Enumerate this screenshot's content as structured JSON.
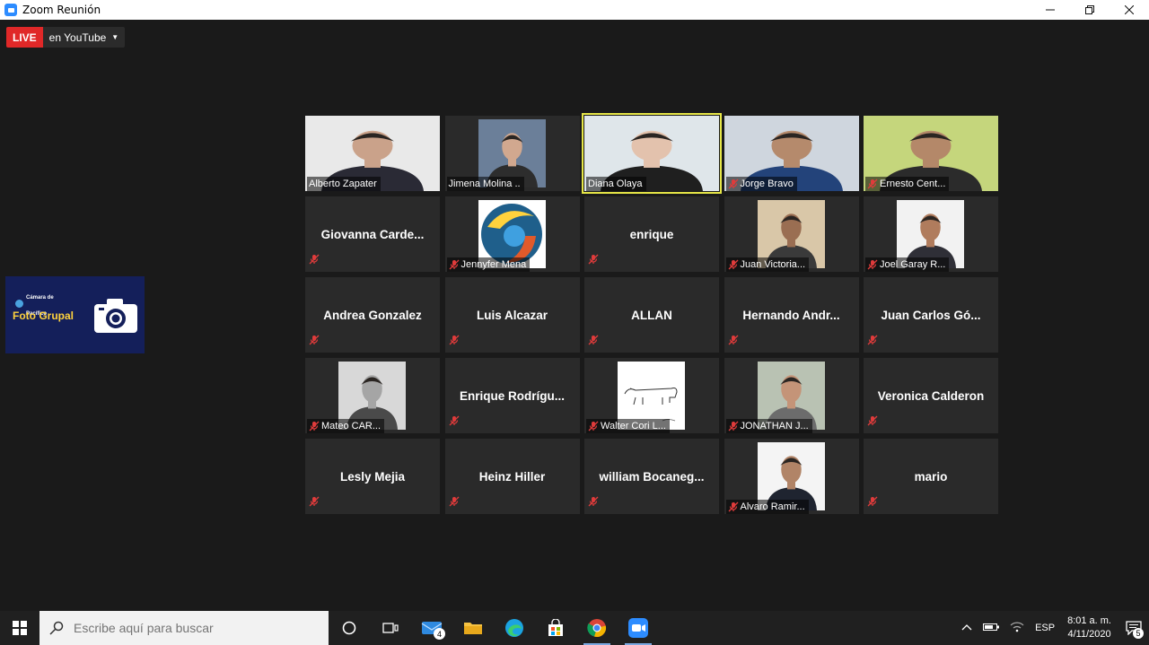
{
  "window": {
    "title": "Zoom Reunión"
  },
  "live": {
    "badge": "LIVE",
    "destination": "en YouTube"
  },
  "foto_grupal": {
    "label": "Foto Grupal",
    "logo_line1": "Cámara de",
    "logo_line2": "Pacífico"
  },
  "participants": [
    {
      "name": "Alberto Zapater",
      "muted": false,
      "kind": "video",
      "bg": "#e9e9e9",
      "skin": "#caa28a",
      "shirt": "#2a2a35"
    },
    {
      "name": "Jimena Molina ..",
      "muted": false,
      "kind": "photo",
      "bg": "#6b7f99",
      "skin": "#d1a88f",
      "shirt": "#2d2d2d"
    },
    {
      "name": "Diana Olaya",
      "muted": false,
      "kind": "video",
      "bg": "#dfe6ea",
      "skin": "#e3c2ad",
      "shirt": "#1f1f1f",
      "speaker": true
    },
    {
      "name": "Jorge Bravo",
      "muted": true,
      "kind": "video",
      "bg": "#cfd6de",
      "skin": "#b58a6c",
      "shirt": "#23437a"
    },
    {
      "name": "Ernesto Cent...",
      "muted": true,
      "kind": "video",
      "bg": "#c5d67c",
      "skin": "#b48869",
      "shirt": "#2b2b2b"
    },
    {
      "name": "Giovanna  Carde...",
      "muted": true,
      "kind": "text"
    },
    {
      "name": "Jennyfer Mena",
      "muted": true,
      "kind": "logo"
    },
    {
      "name": "enrique",
      "muted": true,
      "kind": "text"
    },
    {
      "name": "Juan Victoria...",
      "muted": true,
      "kind": "photo",
      "bg": "#d9c7a8",
      "skin": "#9a6e52",
      "shirt": "#3a3a3a"
    },
    {
      "name": "Joel Garay R...",
      "muted": true,
      "kind": "photo",
      "bg": "#f2f2f2",
      "skin": "#b07c5d",
      "shirt": "#2f2f37"
    },
    {
      "name": "Andrea Gonzalez",
      "muted": true,
      "kind": "text"
    },
    {
      "name": "Luis Alcazar",
      "muted": true,
      "kind": "text"
    },
    {
      "name": "ALLAN",
      "muted": true,
      "kind": "text"
    },
    {
      "name": "Hernando  Andr...",
      "muted": true,
      "kind": "text"
    },
    {
      "name": "Juan Carlos Gó...",
      "muted": true,
      "kind": "text"
    },
    {
      "name": "Mateo CAR...",
      "muted": true,
      "kind": "photo",
      "bg": "#d8d8d8",
      "skin": "#a5a5a5",
      "shirt": "#4a4a4a"
    },
    {
      "name": "Enrique  Rodrígu...",
      "muted": true,
      "kind": "text"
    },
    {
      "name": "Walter Cori L...",
      "muted": true,
      "kind": "sketch"
    },
    {
      "name": "JONATHAN J...",
      "muted": true,
      "kind": "photo",
      "bg": "#b9c2b3",
      "skin": "#c49478",
      "shirt": "#6c6c6c"
    },
    {
      "name": "Veronica Calderon",
      "muted": true,
      "kind": "text"
    },
    {
      "name": "Lesly Mejia",
      "muted": true,
      "kind": "text"
    },
    {
      "name": "Heinz Hiller",
      "muted": true,
      "kind": "text"
    },
    {
      "name": "william  Bocaneg...",
      "muted": true,
      "kind": "text"
    },
    {
      "name": "Alvaro Ramir...",
      "muted": true,
      "kind": "photo",
      "bg": "#f4f4f4",
      "skin": "#b18467",
      "shirt": "#1f2430"
    },
    {
      "name": "mario",
      "muted": true,
      "kind": "text"
    }
  ],
  "taskbar": {
    "search_placeholder": "Escribe aquí para buscar",
    "mail_count": "4",
    "language": "ESP",
    "time": "8:01 a. m.",
    "date": "4/11/2020",
    "notification_count": "5"
  }
}
